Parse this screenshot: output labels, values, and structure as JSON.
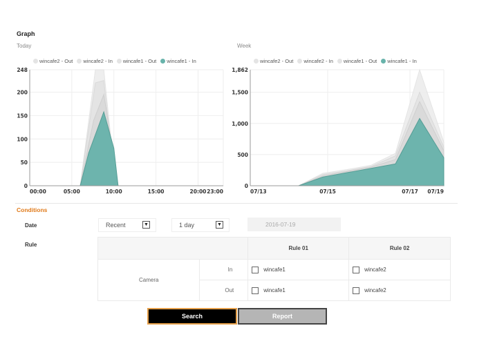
{
  "graph": {
    "title": "Graph",
    "today_label": "Today",
    "week_label": "Week"
  },
  "colors": {
    "accent_teal": "#68b3ab",
    "series_gray": "#dcdcdc",
    "orange": "#e07a1a"
  },
  "chart_data": [
    {
      "type": "area",
      "title": "",
      "legend": [
        "wincafe2 - Out",
        "wincafe2 - In",
        "wincafe1 - Out",
        "wincafe1 - In"
      ],
      "legend_placement": "top",
      "x": [
        "00:00",
        "05:00",
        "10:00",
        "15:00",
        "20:00",
        "23:00"
      ],
      "y_ticks": [
        "0",
        "50",
        "100",
        "150",
        "200",
        "248"
      ],
      "ylim": [
        0,
        248
      ],
      "series": [
        {
          "name": "wincafe2 - Out",
          "points": [
            [
              0,
              0
            ],
            [
              6,
              0
            ],
            [
              7.8,
              248
            ],
            [
              8.8,
              248
            ],
            [
              10,
              40
            ],
            [
              10.5,
              0
            ],
            [
              23,
              0
            ]
          ]
        },
        {
          "name": "wincafe2 - In",
          "points": [
            [
              0,
              0
            ],
            [
              6,
              0
            ],
            [
              7.8,
              220
            ],
            [
              8.8,
              225
            ],
            [
              10,
              30
            ],
            [
              10.5,
              0
            ],
            [
              23,
              0
            ]
          ]
        },
        {
          "name": "wincafe1 - Out",
          "points": [
            [
              0,
              0
            ],
            [
              6,
              0
            ],
            [
              7.6,
              140
            ],
            [
              8.8,
              195
            ],
            [
              10,
              60
            ],
            [
              10.5,
              0
            ],
            [
              23,
              0
            ]
          ]
        },
        {
          "name": "wincafe1 - In",
          "points": [
            [
              0,
              0
            ],
            [
              6,
              0
            ],
            [
              7,
              70
            ],
            [
              8.8,
              158
            ],
            [
              10,
              80
            ],
            [
              10.5,
              0
            ],
            [
              23,
              0
            ]
          ]
        }
      ]
    },
    {
      "type": "area",
      "title": "",
      "legend": [
        "wincafe2 - Out",
        "wincafe2 - In",
        "wincafe1 - Out",
        "wincafe1 - In"
      ],
      "legend_placement": "top",
      "x": [
        "07/13",
        "07/15",
        "07/17",
        "07/19"
      ],
      "y_ticks": [
        "0",
        "500",
        "1,000",
        "1,500",
        "1,862"
      ],
      "ylim": [
        0,
        1862
      ],
      "series": [
        {
          "name": "wincafe2 - Out",
          "points": [
            [
              0,
              0
            ],
            [
              1,
              0
            ],
            [
              1.5,
              200
            ],
            [
              2,
              260
            ],
            [
              2.5,
              330
            ],
            [
              3,
              520
            ],
            [
              3.5,
              1862
            ],
            [
              4,
              700
            ]
          ]
        },
        {
          "name": "wincafe2 - In",
          "points": [
            [
              0,
              0
            ],
            [
              1,
              0
            ],
            [
              1.5,
              180
            ],
            [
              2,
              240
            ],
            [
              2.5,
              310
            ],
            [
              3,
              480
            ],
            [
              3.5,
              1500
            ],
            [
              4,
              620
            ]
          ]
        },
        {
          "name": "wincafe1 - Out",
          "points": [
            [
              0,
              0
            ],
            [
              1,
              0
            ],
            [
              1.5,
              160
            ],
            [
              2,
              230
            ],
            [
              2.5,
              300
            ],
            [
              3,
              420
            ],
            [
              3.5,
              1350
            ],
            [
              4,
              560
            ]
          ]
        },
        {
          "name": "wincafe1 - In",
          "points": [
            [
              0,
              0
            ],
            [
              1,
              0
            ],
            [
              1.5,
              140
            ],
            [
              2,
              210
            ],
            [
              2.5,
              280
            ],
            [
              3,
              350
            ],
            [
              3.5,
              1080
            ],
            [
              4,
              450
            ]
          ]
        }
      ]
    }
  ],
  "conditions": {
    "title": "Conditions",
    "date_label": "Date",
    "range_select": "Recent",
    "period_select": "1 day",
    "date_value": "2016-07-19",
    "rule_label": "Rule"
  },
  "rule_table": {
    "col1": "Rule 01",
    "col2": "Rule 02",
    "camera": "Camera",
    "in": "In",
    "out": "Out",
    "in_rule1": "wincafe1",
    "in_rule2": "wincafe2",
    "out_rule1": "wincafe1",
    "out_rule2": "wincafe2"
  },
  "buttons": {
    "search": "Search",
    "report": "Report"
  }
}
